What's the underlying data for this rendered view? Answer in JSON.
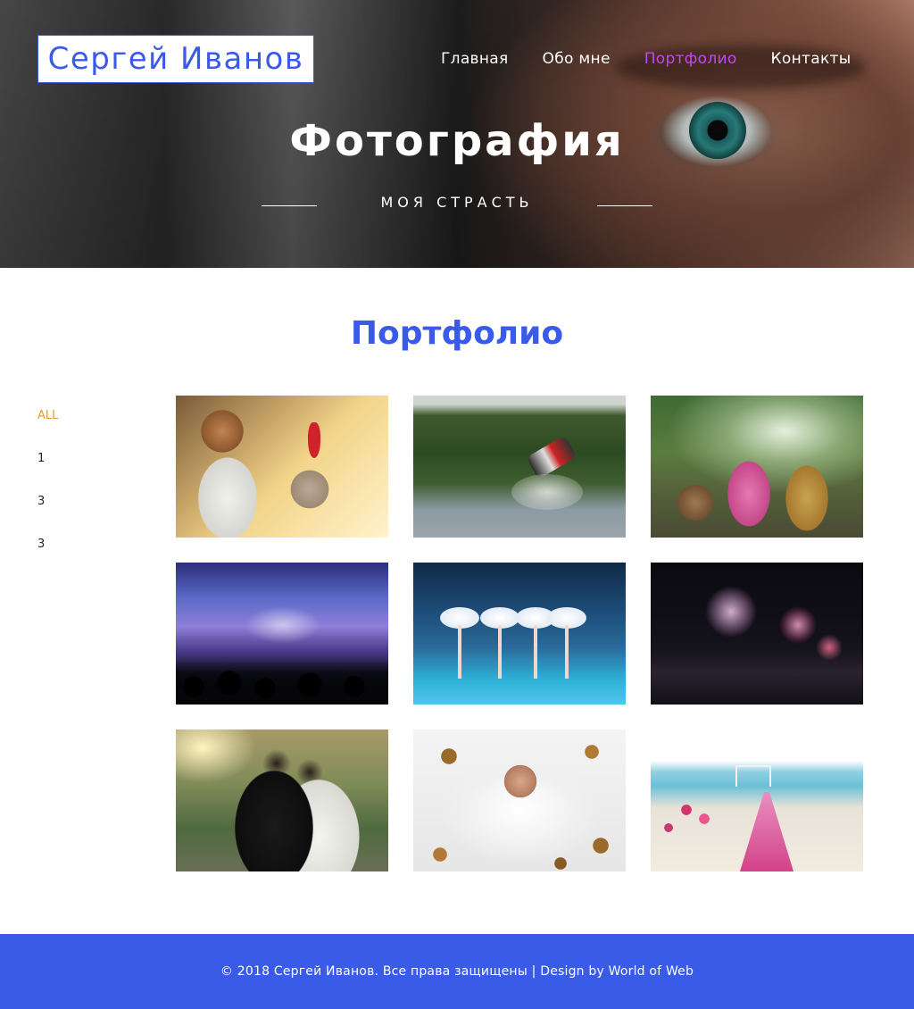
{
  "header": {
    "logo_text": "Сергей Иванов",
    "nav": [
      {
        "label": "Главная",
        "active": false
      },
      {
        "label": "Обо мне",
        "active": false
      },
      {
        "label": "Портфолио",
        "active": true
      },
      {
        "label": "Контакты",
        "active": false
      }
    ],
    "nav_active_color": "#c447f0"
  },
  "hero": {
    "title": "Фотография",
    "subtitle": "МОЯ СТРАСТЬ"
  },
  "portfolio": {
    "title": "Портфолио",
    "filters": [
      {
        "label": "ALL",
        "active": true
      },
      {
        "label": "1",
        "active": false
      },
      {
        "label": "3",
        "active": false
      },
      {
        "label": "3",
        "active": false
      }
    ],
    "filter_active_color": "#e0a030",
    "items": [
      {
        "subject": "boy-with-water-balloon"
      },
      {
        "subject": "wakeboard-jump"
      },
      {
        "subject": "women-sifting-rice"
      },
      {
        "subject": "concert-crowd"
      },
      {
        "subject": "ballet-dancers"
      },
      {
        "subject": "fireworks-over-harbor"
      },
      {
        "subject": "wedding-couple"
      },
      {
        "subject": "bride-with-leaves"
      },
      {
        "subject": "beach-wedding"
      }
    ]
  },
  "footer": {
    "text": "© 2018 Сергей Иванов. Все права защищены | Design by World of Web"
  },
  "colors": {
    "accent": "#3a5ae8"
  }
}
